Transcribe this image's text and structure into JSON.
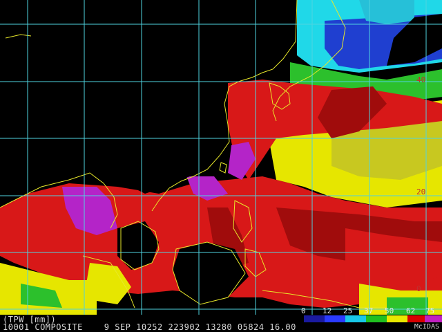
{
  "map": {
    "grid_color": "#4fd3e0",
    "coast_color": "#e8e82a",
    "lat_labels": [
      {
        "text": "40"
      },
      {
        "text": "20"
      },
      {
        "text": "0"
      }
    ]
  },
  "status": {
    "product": "(TPW [mm])",
    "line": "10001 COMPOSITE    9 SEP 10252 223902 13280 05824 16.00"
  },
  "colorbar": {
    "labels": [
      "0",
      "12",
      "25",
      "37",
      "50",
      "62",
      "75"
    ],
    "colors": [
      "#1a1aa0",
      "#2a3aff",
      "#18c8e8",
      "#20c020",
      "#e8e800",
      "#d80000",
      "#c020c0"
    ]
  },
  "credit": "McIDAS",
  "legend": {
    "palette": {
      "black": "#000000",
      "cyan": "#20d8e8",
      "blue": "#1f3fd0",
      "green": "#2cc02c",
      "yellow": "#e6e600",
      "red": "#d81818",
      "darkred": "#a00c0c",
      "magenta": "#b424c8"
    }
  }
}
